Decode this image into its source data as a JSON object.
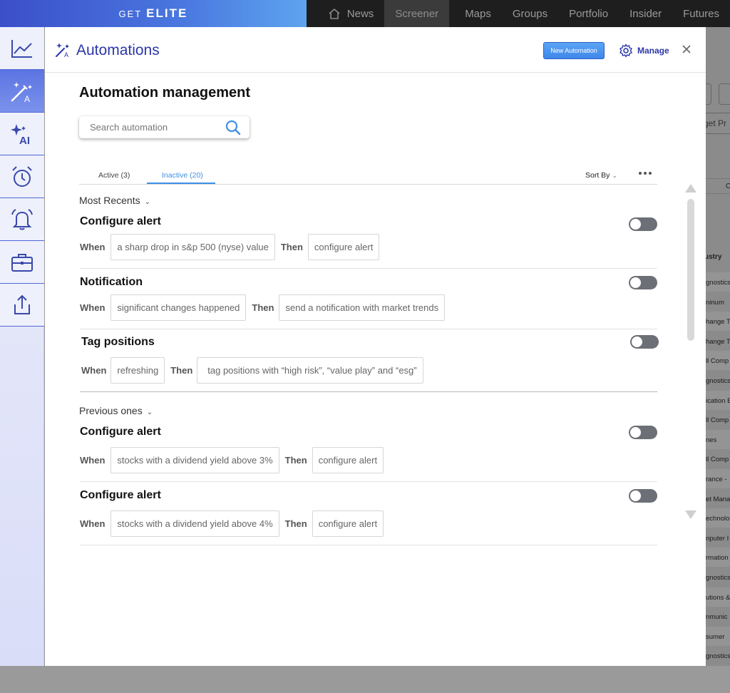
{
  "topbar": {
    "brand_get": "GET",
    "brand_elite": "ELITE",
    "nav": [
      {
        "label": "News",
        "icon": "home-icon"
      },
      {
        "label": "Screener"
      },
      {
        "label": "Maps"
      },
      {
        "label": "Groups"
      },
      {
        "label": "Portfolio"
      },
      {
        "label": "Insider"
      },
      {
        "label": "Futures"
      }
    ]
  },
  "rail": {
    "items": [
      {
        "icon": "chart-line-icon"
      },
      {
        "icon": "magic-wand-icon",
        "active": true
      },
      {
        "icon": "ai-sparkle-icon"
      },
      {
        "icon": "alarm-clock-icon"
      },
      {
        "icon": "bell-icon"
      },
      {
        "icon": "briefcase-icon"
      },
      {
        "icon": "share-icon"
      }
    ]
  },
  "panel": {
    "title": "Automations",
    "new_button": "New Automation",
    "manage_button": "Manage",
    "heading": "Automation management",
    "search_placeholder": "Search automation",
    "tabs": {
      "active": "Active (3)",
      "inactive": "Inactive (20)"
    },
    "sort_by": "Sort By",
    "sections": [
      {
        "label": "Most Recents"
      },
      {
        "label": "Previous ones"
      }
    ],
    "automations": [
      {
        "title": "Configure alert",
        "when": "When",
        "condition": "a sharp drop in s&p 500 (nyse)  value",
        "then": "Then",
        "action": "configure alert",
        "enabled": false
      },
      {
        "title": "Notification",
        "when": "When",
        "condition": "significant changes happened",
        "then": "Then",
        "action": "send a notification with market trends",
        "enabled": false
      },
      {
        "title": "Tag positions",
        "when": "When",
        "condition": "refreshing",
        "then": "Then",
        "action": "tag positions with  “high risk”, “value play” and “esg”",
        "enabled": false
      },
      {
        "title": "Configure alert",
        "when": "When",
        "condition": "stocks with a dividend yield above 3%",
        "then": "Then",
        "action": "configure alert",
        "enabled": false
      },
      {
        "title": "Configure alert",
        "when": "When",
        "condition": "stocks with a dividend yield above 4%",
        "then": "Then",
        "action": "configure alert",
        "enabled": false
      }
    ]
  },
  "background": {
    "search_fragment": "get Pr",
    "column_header_fragment": "C",
    "industry_header": "ustry",
    "cells": [
      "gnostics",
      "ninum",
      "hange T",
      "hange T",
      "ll Comp",
      "gnostics",
      "ication E",
      "ll Comp",
      "nes",
      "ll Comp",
      "rance -",
      "et Mana",
      "echnolo",
      "nputer I",
      "rmation",
      "gnostics",
      "utions &",
      "nmunic",
      "sumer",
      "gnostics"
    ]
  },
  "colors": {
    "brand": "#2c37a8",
    "accent": "#3e8fe6",
    "toggle_off": "#6c6f76"
  }
}
